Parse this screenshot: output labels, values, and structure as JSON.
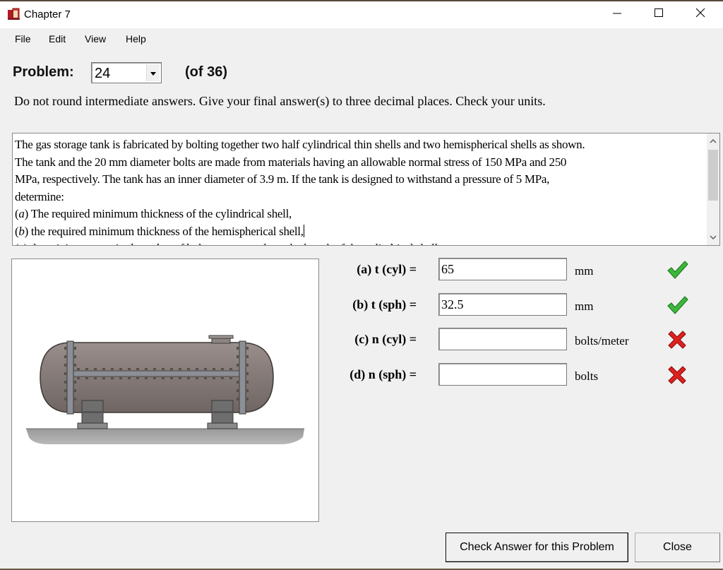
{
  "window": {
    "title": "Chapter 7",
    "icons": {
      "app": "book-icon",
      "minimize": "minimize-icon",
      "maximize": "maximize-icon",
      "close": "close-icon"
    }
  },
  "menu": {
    "items": [
      {
        "label": "File"
      },
      {
        "label": "Edit"
      },
      {
        "label": "View"
      },
      {
        "label": "Help"
      }
    ]
  },
  "problem": {
    "label": "Problem:",
    "selected": "24",
    "of_total": "(of 36)"
  },
  "instructions": "Do not round intermediate answers.  Give your final answer(s) to three decimal places.  Check your units.",
  "statement": {
    "intro_lines": [
      "The gas storage tank is fabricated by bolting together two half cylindrical thin shells and two hemispherical shells as shown.",
      "The tank and the 20 mm diameter bolts are made from materials having an allowable normal stress of 150 MPa and 250",
      "MPa, respectively.  The tank has an inner diameter of 3.9 m.  If the tank is designed to withstand a pressure of 5 MPa,",
      "determine:"
    ],
    "parts": [
      {
        "tag": "a",
        "text": " The required minimum thickness of the cylindrical shell,"
      },
      {
        "tag": "b",
        "text": " the required minimum thickness of the hemispherical shell,"
      },
      {
        "tag": "c",
        "text": " the minimum required number of bolts per meter along the length of the cylindrical shell,"
      }
    ]
  },
  "figure": {
    "description": "gas storage tank on two saddle supports"
  },
  "answers": [
    {
      "label": "(a) t (cyl) =",
      "value": "65",
      "unit": "mm",
      "status": "correct"
    },
    {
      "label": "(b) t (sph) =",
      "value": "32.5",
      "unit": "mm",
      "status": "correct"
    },
    {
      "label": "(c) n (cyl) =",
      "value": "",
      "unit": "bolts/meter",
      "status": "incorrect"
    },
    {
      "label": "(d) n (sph) =",
      "value": "",
      "unit": "bolts",
      "status": "incorrect"
    }
  ],
  "colors": {
    "correct": "#3cb83c",
    "incorrect": "#e02020"
  },
  "buttons": {
    "check": "Check Answer for this Problem",
    "close": "Close"
  }
}
